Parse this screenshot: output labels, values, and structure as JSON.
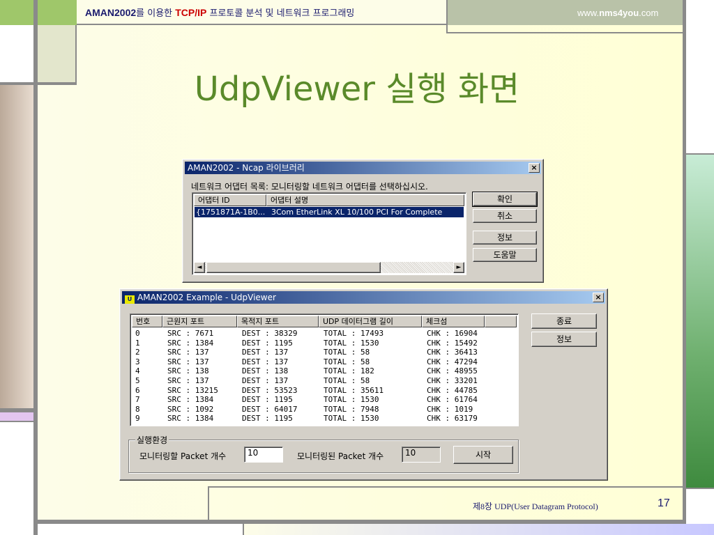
{
  "header": {
    "brand": "AMAN2002",
    "text1": "를 이용한 ",
    "tcpip": "TCP/IP",
    "text2": " 프로토콜 분석 및 네트워크 프로그래밍",
    "url_prefix": "www.",
    "url_bold": "nms4you",
    "url_suffix": ".com"
  },
  "slide_title": "UdpViewer 실행 화면",
  "footer": {
    "chapter": "제8장  UDP(User Datagram Protocol)",
    "page": "17"
  },
  "ncap_dialog": {
    "title": "AMAN2002 - Ncap 라이브러리",
    "close": "×",
    "instruction": "네트워크 어댑터 목록: 모니터링할 네트워크 어댑터를 선택하십시오.",
    "columns": [
      "어댑터 ID",
      "어댑터 설명"
    ],
    "adapter_id": "{1751871A-1B0...",
    "adapter_desc": "3Com EtherLink XL 10/100 PCI For Complete",
    "buttons": {
      "ok": "확인",
      "cancel": "취소",
      "info": "정보",
      "help": "도움말"
    },
    "scroll_left": "◄",
    "scroll_right": "►"
  },
  "udp_window": {
    "title": "AMAN2002 Example - UdpViewer",
    "close": "×",
    "columns": [
      "번호",
      "근원지 포트",
      "목적지 포트",
      "UDP 데이터그램 길이",
      "체크섬"
    ],
    "rows": [
      {
        "no": "0",
        "src": "SRC  : 7671",
        "dest": "DEST : 38329",
        "total": "TOTAL : 17493",
        "chk": "CHK : 16904"
      },
      {
        "no": "1",
        "src": "SRC  : 1384",
        "dest": "DEST : 1195",
        "total": "TOTAL : 1530",
        "chk": "CHK : 15492"
      },
      {
        "no": "2",
        "src": "SRC  : 137",
        "dest": "DEST : 137",
        "total": "TOTAL : 58",
        "chk": "CHK : 36413"
      },
      {
        "no": "3",
        "src": "SRC  : 137",
        "dest": "DEST : 137",
        "total": "TOTAL : 58",
        "chk": "CHK : 47294"
      },
      {
        "no": "4",
        "src": "SRC  : 138",
        "dest": "DEST : 138",
        "total": "TOTAL : 182",
        "chk": "CHK : 48955"
      },
      {
        "no": "5",
        "src": "SRC  : 137",
        "dest": "DEST : 137",
        "total": "TOTAL : 58",
        "chk": "CHK : 33201"
      },
      {
        "no": "6",
        "src": "SRC  : 13215",
        "dest": "DEST : 53523",
        "total": "TOTAL : 35611",
        "chk": "CHK : 44785"
      },
      {
        "no": "7",
        "src": "SRC  : 1384",
        "dest": "DEST : 1195",
        "total": "TOTAL : 1530",
        "chk": "CHK : 61764"
      },
      {
        "no": "8",
        "src": "SRC  : 1092",
        "dest": "DEST : 64017",
        "total": "TOTAL : 7948",
        "chk": "CHK : 1019"
      },
      {
        "no": "9",
        "src": "SRC  : 1384",
        "dest": "DEST : 1195",
        "total": "TOTAL : 1530",
        "chk": "CHK : 63179"
      }
    ],
    "buttons": {
      "exit": "종료",
      "info": "정보",
      "start": "시작"
    },
    "group_label": "실행환경",
    "monitor_label": "모니터링할 Packet 개수",
    "monitor_value": "10",
    "monitored_label": "모니터링된 Packet 개수",
    "monitored_value": "10"
  },
  "colors": {
    "title_green": "#5a8a2a",
    "header_blue": "#1a1a6e",
    "accent_red": "#cc0000",
    "titlebar": "#0a246a"
  }
}
